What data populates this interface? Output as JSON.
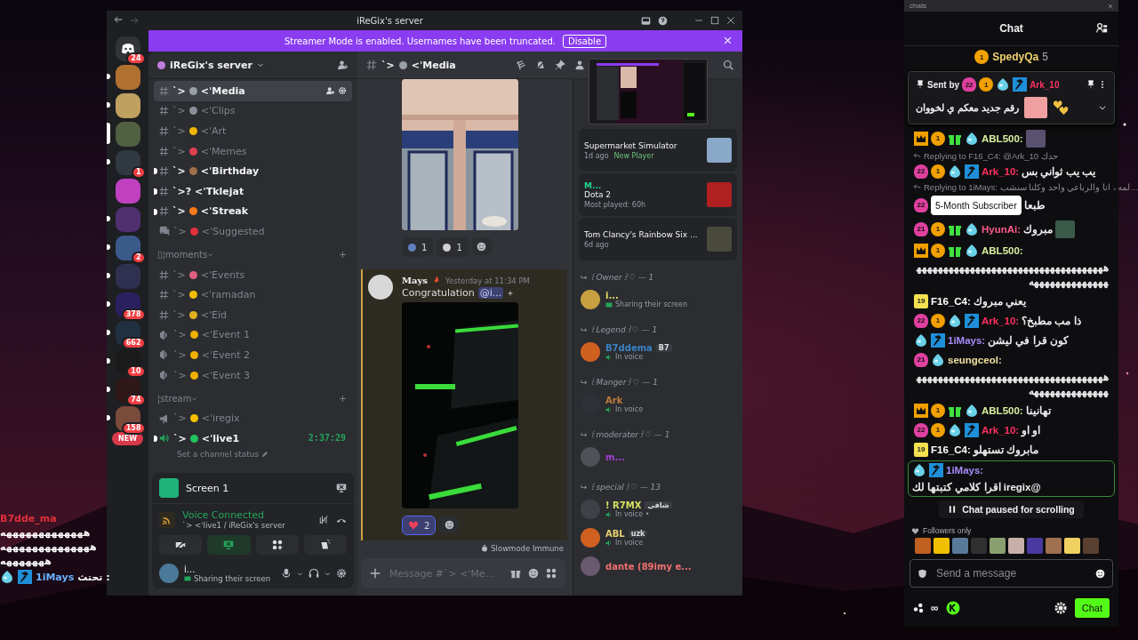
{
  "discord": {
    "title": "iReGix's server",
    "banner": {
      "text": "Streamer Mode is enabled. Usernames have been truncated.",
      "button": "Disable"
    },
    "servers": [
      {
        "kind": "home",
        "badge": "24",
        "unread": false,
        "selected": false
      },
      {
        "kind": "server",
        "unread": true,
        "selected": false
      },
      {
        "kind": "server",
        "unread": true,
        "selected": false
      },
      {
        "kind": "server",
        "selected": true
      },
      {
        "kind": "server",
        "badge": "1",
        "unread": true,
        "selected": false
      },
      {
        "kind": "server",
        "unread": false,
        "selected": false
      },
      {
        "kind": "server",
        "unread": true,
        "selected": false
      },
      {
        "kind": "server",
        "badge": "2",
        "unread": true,
        "selected": false
      },
      {
        "kind": "server",
        "unread": true,
        "selected": false
      },
      {
        "kind": "server",
        "badge": "378",
        "unread": true,
        "selected": false
      },
      {
        "kind": "server",
        "badge": "662",
        "unread": true,
        "selected": false
      },
      {
        "kind": "server",
        "badge": "10",
        "unread": true,
        "selected": false
      },
      {
        "kind": "server",
        "badge": "74",
        "unread": true,
        "selected": false
      },
      {
        "kind": "server",
        "badge": "158",
        "unread": true,
        "selected": false
      }
    ],
    "new_pill": "NEW",
    "server_name": "iReGix's server",
    "sections": [
      {
        "items": [
          {
            "kind": "text",
            "prefix": "ˋ>",
            "name": "<ˈMedia",
            "color": "#9aa0a8",
            "selected": true,
            "unread": false
          },
          {
            "kind": "text",
            "prefix": "ˋ>",
            "name": "<ˈClips",
            "color": "#8a8f99",
            "selected": false,
            "unread": false
          },
          {
            "kind": "text",
            "prefix": "ˋ>",
            "name": "<ˈArt",
            "color": "#f0b400",
            "selected": false,
            "unread": false
          },
          {
            "kind": "text",
            "prefix": "ˋ>",
            "name": "<ˈMemes",
            "color": "#e04050",
            "selected": false,
            "unread": false
          },
          {
            "kind": "text",
            "prefix": "ˋ>",
            "name": "<ˈBirthday",
            "color": "#a0704a",
            "selected": false,
            "unread": true
          },
          {
            "kind": "text",
            "prefix": "ˋ>?",
            "name": "<ˈTklejat",
            "selected": false,
            "unread": true
          },
          {
            "kind": "text",
            "prefix": "ˋ>",
            "name": "<ˈStreak",
            "color": "#ff7a1a",
            "selected": false,
            "unread": true
          },
          {
            "kind": "forum",
            "prefix": "ˋ>",
            "name": "<ˈSuggested",
            "color": "#e0303a",
            "selected": false,
            "unread": false
          }
        ]
      },
      {
        "title": "▯¦moments",
        "items": [
          {
            "kind": "text",
            "prefix": "ˋ>",
            "name": "<ˈEvents",
            "color": "#e06080",
            "selected": false,
            "unread": false
          },
          {
            "kind": "text",
            "prefix": "ˋ>",
            "name": "<ˈramadan",
            "color": "#f0c000",
            "selected": false,
            "unread": false
          },
          {
            "kind": "text",
            "prefix": "ˋ>",
            "name": "<ˈEid",
            "color": "#e0b020",
            "selected": false,
            "unread": false
          },
          {
            "kind": "stage",
            "prefix": "ˋ>",
            "name": "<ˈEvent 1",
            "color": "#f0b000",
            "selected": false,
            "unread": false
          },
          {
            "kind": "stage",
            "prefix": "ˋ>",
            "name": "<ˈEvent 2",
            "color": "#f0b000",
            "selected": false,
            "unread": false
          },
          {
            "kind": "stage",
            "prefix": "ˋ>",
            "name": "<ˈEvent 3",
            "color": "#f0b000",
            "selected": false,
            "unread": false
          }
        ]
      },
      {
        "title": "¦stream",
        "items": [
          {
            "kind": "announcement",
            "prefix": "ˋ>",
            "name": "<ˈiregix",
            "color": "#f5c000",
            "selected": false,
            "unread": false
          },
          {
            "kind": "voice",
            "prefix": "ˋ>",
            "name": "<ˈlive1",
            "color": "#22c55e",
            "selected": false,
            "unread": true,
            "timer": "2:37:29",
            "status": "Set a channel status"
          }
        ]
      }
    ],
    "screen_panel": {
      "title": "Screen 1",
      "voice_status": "Voice Connected",
      "voice_channel": "ˋ>  <ˈlive1 / iReGix's server",
      "user": "i...",
      "user_status": "Sharing their screen"
    },
    "chat": {
      "channel_prefix": "ˋ>",
      "channel": "<ˈMedia",
      "reactions_top": [
        {
          "count": "1",
          "selected": false
        },
        {
          "count": "1",
          "selected": false
        }
      ],
      "message": {
        "author": "Mays",
        "time": "Yesterday at 11:34 PM",
        "text": "Congratulation",
        "mention": "@i...",
        "reactions": [
          {
            "count": "2",
            "selected": true
          }
        ]
      },
      "slowmode": "Slowmode Immune",
      "placeholder": "Message #ˋ> <ˈMe..."
    },
    "activities": [
      {
        "title": "Supermarket Simulator",
        "meta": "1d ago",
        "extra": "New Player"
      },
      {
        "user": "M...",
        "title": "Dota 2",
        "meta": "Most played: 60h"
      },
      {
        "title": "Tom Clancy's Rainbow Six ...",
        "meta": "6d ago"
      }
    ],
    "roles": [
      {
        "title": "↪ ꒰Owner꒱♡ — 1",
        "members": [
          {
            "name": "i...",
            "color": "#e8dc60",
            "status": "Sharing their screen",
            "kind": "screen"
          }
        ]
      },
      {
        "title": "↪ ꒰Legend꒱♡ — 1",
        "members": [
          {
            "name": "B7ddema",
            "color": "#3b82c4",
            "tag": "B7",
            "status": "In voice",
            "kind": "voice"
          }
        ]
      },
      {
        "title": "↪ ꒰Manger꒱♡ — 1",
        "members": [
          {
            "name": "Ark",
            "color": "#c27c3a",
            "status": "In voice",
            "kind": "voice"
          }
        ]
      },
      {
        "title": "↪ ꒰moderater꒱♡ — 1",
        "members": [
          {
            "name": "m...",
            "color": "#a040d0"
          }
        ]
      },
      {
        "title": "↪ ꒰special꒱♡ — 13",
        "members": [
          {
            "name": "! R7MX",
            "color": "#d8e060",
            "tag": "شافي",
            "status": "In voice •",
            "kind": "voice"
          },
          {
            "name": "ABL",
            "color": "#e8d070",
            "tag": "uzk",
            "status": "In voice",
            "kind": "voice"
          },
          {
            "name": "dante (89imy e...",
            "color": "#f07070"
          }
        ]
      }
    ]
  },
  "overlay_chat": [
    {
      "user": "B7dde_ma"
    },
    {
      "text": "هههههههههههههه"
    },
    {
      "text": "ههههههههههههههه"
    },
    {
      "text": "هههههههه"
    },
    {
      "badges": [
        {
          "kind": "drop"
        },
        {
          "kind": "hammer"
        }
      ],
      "user": "1iMays",
      "text": ": تحتث"
    }
  ],
  "twitch": {
    "window_title": "chats",
    "header": "Chat",
    "top_user": {
      "badges": [
        {
          "kind": "coin",
          "text": "1"
        }
      ],
      "name": "SpedyQa",
      "count": "5"
    },
    "pinned": {
      "label": "Sent by",
      "badges": [
        {
          "kind": "sub",
          "text": "22"
        },
        {
          "kind": "coin",
          "text": "1"
        },
        {
          "kind": "drop"
        },
        {
          "kind": "hammer"
        }
      ],
      "user": "Ark_10",
      "text": "رقم جديد معكم ي لخووان"
    },
    "messages": [
      {
        "badges": [
          {
            "kind": "crown"
          },
          {
            "kind": "coin",
            "text": "1"
          },
          {
            "kind": "gift"
          },
          {
            "kind": "drop"
          }
        ],
        "user": "ABL500:",
        "color": "#d8f0a0",
        "emote": true,
        "highlighted": false
      },
      {
        "reply": "Replying to F16_C4: @Ark_10 حدك",
        "badges": [
          {
            "kind": "sub",
            "text": "22"
          },
          {
            "kind": "coin",
            "text": "1"
          },
          {
            "kind": "drop"
          },
          {
            "kind": "hammer"
          }
        ],
        "user": "Ark_10:",
        "color": "#ff3060",
        "text": "يب يب ثواني بس",
        "highlighted": false
      },
      {
        "reply": "Replying to 1iMays: لمه ، انا والرباعي واحد وكلنا سنشب...",
        "badges": [
          {
            "kind": "sub",
            "text": "22"
          }
        ],
        "text": "طبعا",
        "highlighted": false
      },
      {
        "badges": [
          {
            "kind": "sub",
            "text": "21"
          },
          {
            "kind": "coin",
            "text": "1"
          },
          {
            "kind": "gift"
          },
          {
            "kind": "drop"
          }
        ],
        "user": "HyunAi:",
        "color": "#ff5a8a",
        "text": "مبروك",
        "emote": true,
        "highlighted": false
      },
      {
        "badges": [
          {
            "kind": "crown"
          },
          {
            "kind": "coin",
            "text": "1"
          },
          {
            "kind": "gift"
          },
          {
            "kind": "drop"
          }
        ],
        "user": "ABL500:",
        "color": "#d8f0a0",
        "text": "ههههههههههههههههههههههههههههههههههههههههههههههههههه",
        "highlighted": false
      },
      {
        "badges": [
          {
            "kind": "level",
            "text": "19"
          }
        ],
        "user": "F16_C4:",
        "color": "#ffffff",
        "text": "يعني مبروك",
        "highlighted": false
      },
      {
        "badges": [
          {
            "kind": "sub",
            "text": "22"
          },
          {
            "kind": "coin",
            "text": "1"
          },
          {
            "kind": "drop"
          },
          {
            "kind": "hammer"
          }
        ],
        "user": "Ark_10:",
        "color": "#ff3060",
        "text": "ذا مب مطبخ؟",
        "highlighted": false
      },
      {
        "badges": [
          {
            "kind": "drop"
          },
          {
            "kind": "hammer"
          }
        ],
        "user": "1iMays:",
        "color": "#a78bfa",
        "text": "كون قرا في ليشن",
        "highlighted": false
      },
      {
        "badges": [
          {
            "kind": "sub",
            "text": "21"
          },
          {
            "kind": "drop"
          }
        ],
        "user": "seungceol:",
        "color": "#f0e0a0",
        "text": "ههههههههههههههههههههههههههههههههههههههههههههههههههه",
        "highlighted": false
      },
      {
        "badges": [
          {
            "kind": "crown"
          },
          {
            "kind": "coin",
            "text": "1"
          },
          {
            "kind": "gift"
          },
          {
            "kind": "drop"
          }
        ],
        "user": "ABL500:",
        "color": "#d8f0a0",
        "text": "تهانينا",
        "highlighted": false
      },
      {
        "badges": [
          {
            "kind": "sub",
            "text": "22"
          },
          {
            "kind": "coin",
            "text": "1"
          },
          {
            "kind": "drop"
          },
          {
            "kind": "hammer"
          }
        ],
        "user": "Ark_10:",
        "color": "#ff3060",
        "text": "او او",
        "highlighted": false
      },
      {
        "badges": [
          {
            "kind": "level",
            "text": "19"
          }
        ],
        "user": "F16_C4:",
        "color": "#ffffff",
        "text": "مابروك تستهلو",
        "highlighted": false
      },
      {
        "badges": [
          {
            "kind": "drop"
          },
          {
            "kind": "hammer"
          }
        ],
        "user": "1iMays:",
        "color": "#a78bfa",
        "text": "@iregix اقرا كلامي كتبتها لك",
        "highlighted": true
      }
    ],
    "tooltip": "5-Month Subscriber",
    "paused": "Chat paused for scrolling",
    "followers": "Followers only",
    "placeholder": "Send a message",
    "points": "∞",
    "chat_button": "Chat"
  }
}
